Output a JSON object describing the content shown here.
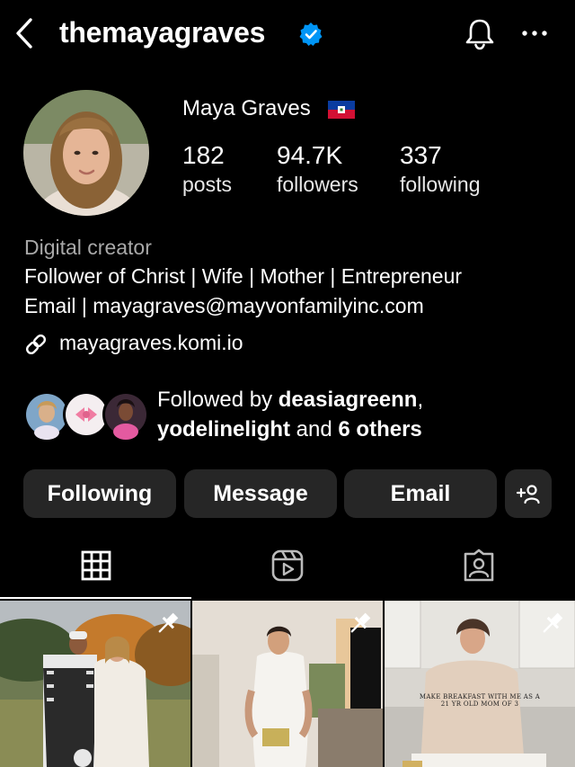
{
  "header": {
    "username": "themayagraves",
    "verified_icon": "verified-badge-icon",
    "back_icon": "chevron-left-icon",
    "notification_icon": "bell-icon",
    "more_icon": "more-horizontal-icon"
  },
  "profile": {
    "display_name": "Maya Graves",
    "flag_icon": "haiti-flag-icon",
    "stats": [
      {
        "value": "182",
        "label": "posts"
      },
      {
        "value": "94.7K",
        "label": "followers"
      },
      {
        "value": "337",
        "label": "following"
      }
    ],
    "category": "Digital creator",
    "bio_line1": "Follower of Christ | Wife | Mother | Entrepreneur",
    "bio_line2": "Email | mayagraves@mayvonfamilyinc.com",
    "link": "mayagraves.komi.io",
    "followed_by": {
      "prefix": "Followed by ",
      "user1": "deasiagreenn",
      "comma": ",",
      "user2": "yodelinelight",
      "and_text": " and ",
      "others": "6 others"
    }
  },
  "actions": {
    "following": "Following",
    "message": "Message",
    "email": "Email",
    "add_icon": "add-person-icon"
  },
  "tabs": [
    {
      "icon": "grid-icon",
      "active": true
    },
    {
      "icon": "reels-icon",
      "active": false
    },
    {
      "icon": "tagged-icon",
      "active": false
    }
  ],
  "posts": [
    {
      "pinned": true,
      "overlay": ""
    },
    {
      "pinned": true,
      "overlay": ""
    },
    {
      "pinned": true,
      "overlay_line1": "MAKE BREAKFAST WITH ME AS A",
      "overlay_line2": "21 YR OLD MOM OF 3"
    }
  ]
}
